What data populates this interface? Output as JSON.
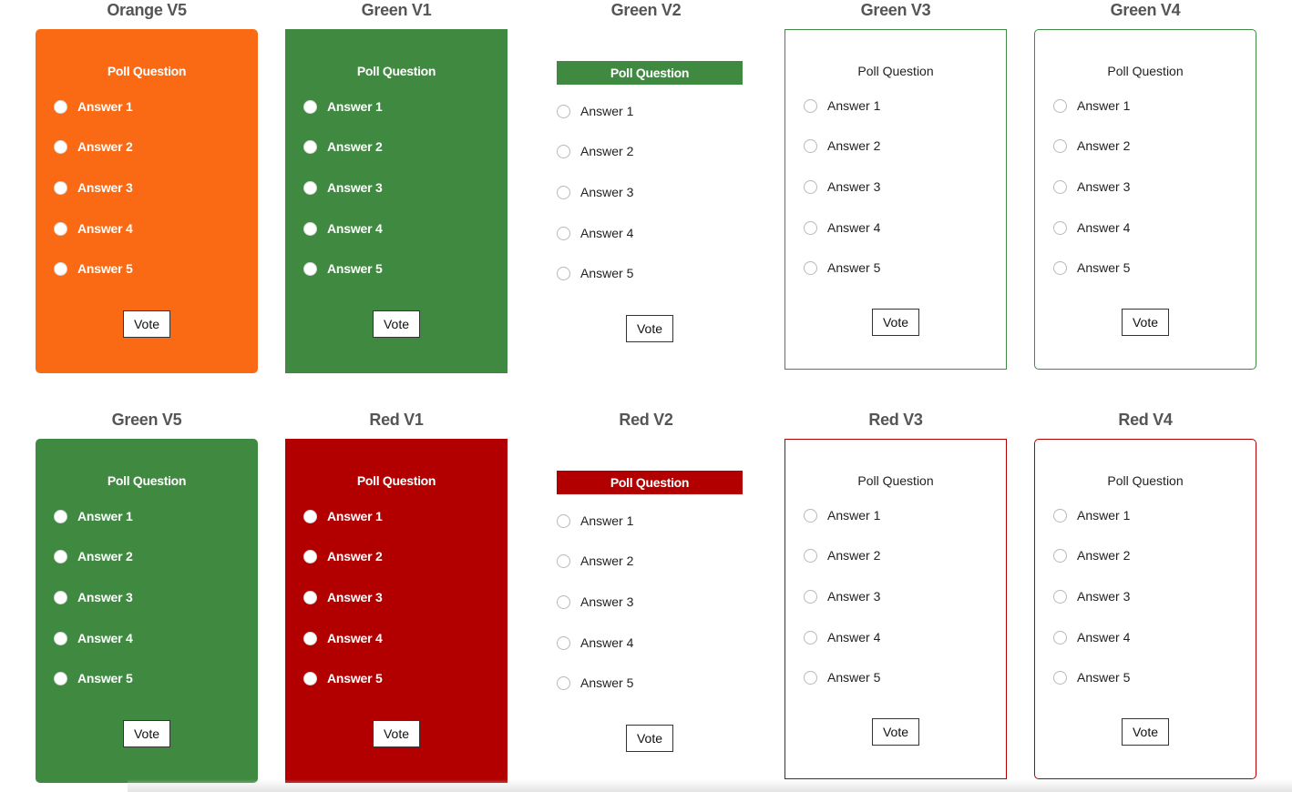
{
  "colors": {
    "orange": "#fa6a14",
    "green": "#3f8a40",
    "red": "#b20000",
    "title_gray": "#555555"
  },
  "common": {
    "question": "Poll Question",
    "answers": [
      "Answer 1",
      "Answer 2",
      "Answer 3",
      "Answer 4",
      "Answer 5"
    ],
    "vote_label": "Vote"
  },
  "variants": [
    {
      "title": "Orange V5",
      "style": "v5",
      "color": "#fa6a14"
    },
    {
      "title": "Green V1",
      "style": "v1",
      "color": "#3f8a40"
    },
    {
      "title": "Green V2",
      "style": "v2",
      "color": "#3f8a40"
    },
    {
      "title": "Green V3",
      "style": "v3",
      "color": "#3f8a40"
    },
    {
      "title": "Green V4",
      "style": "v4",
      "color": "#3f8a40"
    },
    {
      "title": "Green V5",
      "style": "v5",
      "color": "#3f8a40"
    },
    {
      "title": "Red V1",
      "style": "v1",
      "color": "#b20000"
    },
    {
      "title": "Red V2",
      "style": "v2",
      "color": "#b20000"
    },
    {
      "title": "Red V3",
      "style": "v3",
      "color": "#b20000"
    },
    {
      "title": "Red V4",
      "style": "v4",
      "color": "#b20000"
    }
  ]
}
